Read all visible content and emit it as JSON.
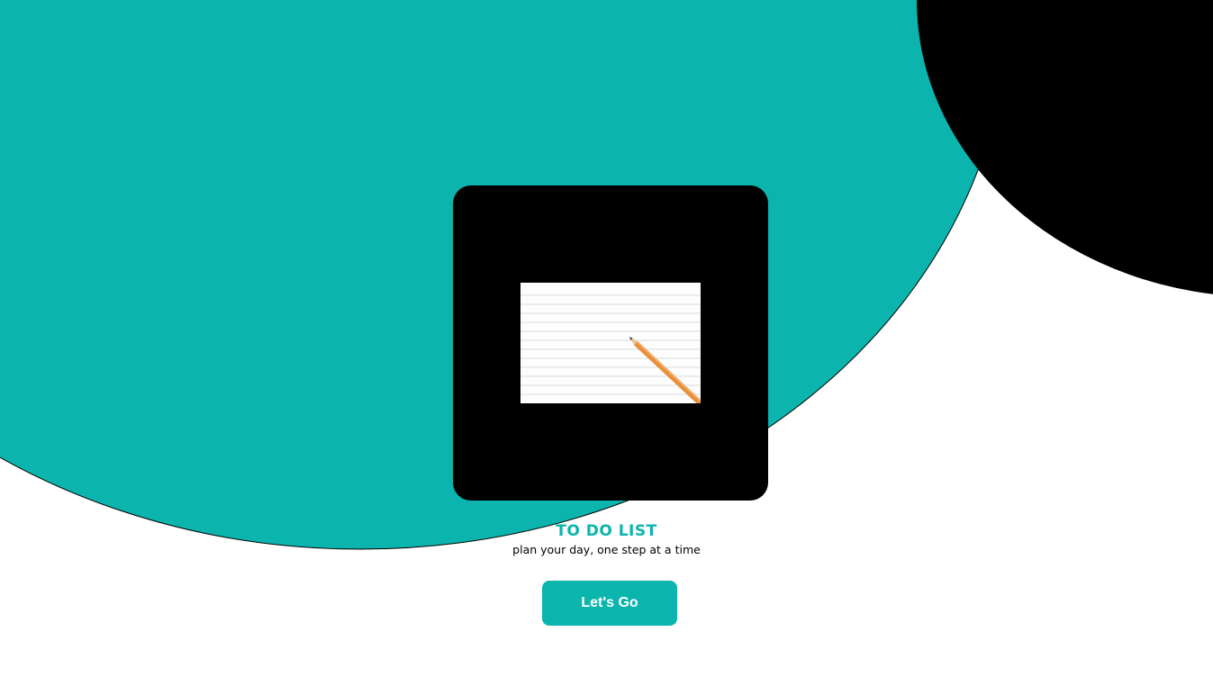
{
  "colors": {
    "accent": "#0bb5ad",
    "dark": "#000000",
    "background": "#ffffff"
  },
  "hero": {
    "image_icon": "notepad-with-pencil-image",
    "title": "TO DO LIST",
    "subtitle": "plan your day, one step at a time",
    "cta_label": "Let's Go"
  }
}
